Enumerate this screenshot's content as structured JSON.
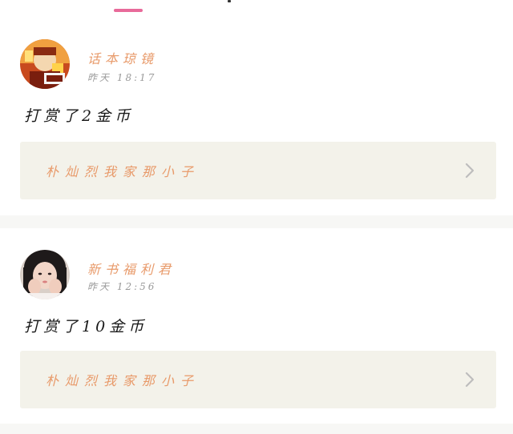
{
  "colors": {
    "accent": "#e86a9a",
    "username": "#e89a6a",
    "book_title": "#e89a6a",
    "chevron": "#bdbdbd"
  },
  "feed": [
    {
      "username": "话本琼镜",
      "timestamp": "昨天 18:17",
      "action": "打赏了2金币",
      "book_title": "朴灿烈我家那小子",
      "avatar_icon": "cartoon-avatar-icon"
    },
    {
      "username": "新书福利君",
      "timestamp": "昨天 12:56",
      "action": "打赏了10金币",
      "book_title": "朴灿烈我家那小子",
      "avatar_icon": "photo-avatar-icon"
    }
  ]
}
